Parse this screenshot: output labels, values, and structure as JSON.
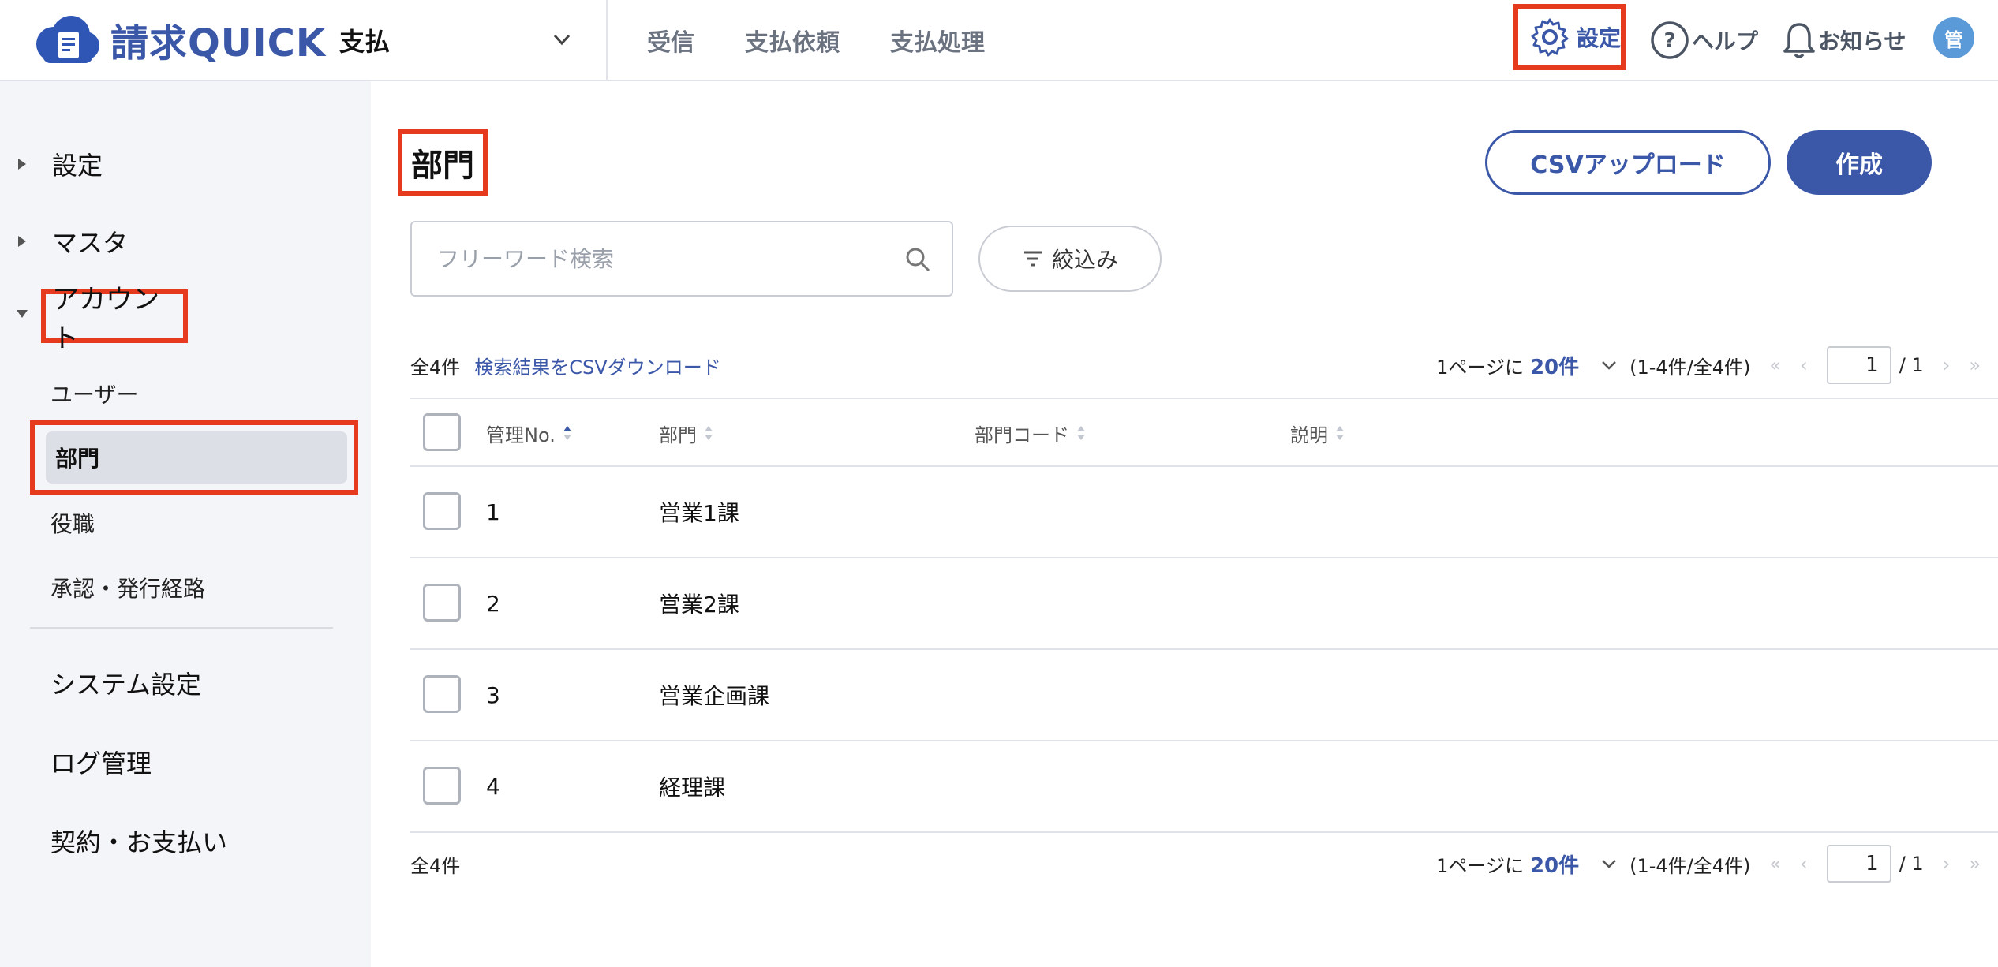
{
  "header": {
    "logo_text": "請求QUICK",
    "module": "支払",
    "nav": [
      "受信",
      "支払依頼",
      "支払処理"
    ],
    "settings_label": "設定",
    "help_label": "ヘルプ",
    "notice_label": "お知らせ",
    "avatar_label": "管"
  },
  "sidebar": {
    "groups": [
      {
        "label": "設定",
        "expanded": false
      },
      {
        "label": "マスタ",
        "expanded": false
      },
      {
        "label": "アカウント",
        "expanded": true
      }
    ],
    "account_items": [
      "ユーザー",
      "部門",
      "役職",
      "承認・発行経路"
    ],
    "active_item": "部門",
    "bottom_items": [
      "システム設定",
      "ログ管理",
      "契約・お支払い"
    ]
  },
  "main": {
    "title": "部門",
    "csv_upload_label": "CSVアップロード",
    "create_label": "作成",
    "search": {
      "placeholder": "フリーワード検索",
      "value": ""
    },
    "filter_label": "絞込み",
    "total_label": "全4件",
    "csv_download_label": "検索結果をCSVダウンロード",
    "pager": {
      "per_page_prefix": "1ページに",
      "per_page": "20件",
      "range": "(1-4件/全4件)",
      "first": "«",
      "prev": "‹",
      "next": "›",
      "last": "»",
      "current_page": "1",
      "of_label": "/ 1"
    },
    "columns": [
      "管理No.",
      "部門",
      "部門コード",
      "説明"
    ],
    "rows": [
      {
        "no": "1",
        "dept": "営業1課",
        "code": "",
        "desc": ""
      },
      {
        "no": "2",
        "dept": "営業2課",
        "code": "",
        "desc": ""
      },
      {
        "no": "3",
        "dept": "営業企画課",
        "code": "",
        "desc": ""
      },
      {
        "no": "4",
        "dept": "経理課",
        "code": "",
        "desc": ""
      }
    ]
  },
  "colors": {
    "accent": "#3b57a8",
    "highlight": "#e63a1f",
    "sidebar_bg": "#f4f5f8"
  }
}
